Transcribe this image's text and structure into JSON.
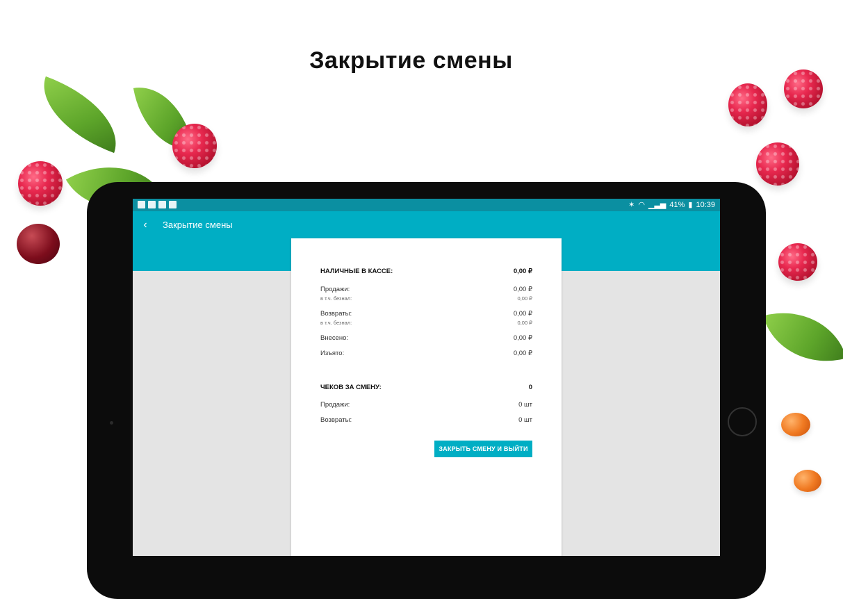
{
  "headline": "Закрытие смены",
  "status_bar": {
    "battery": "41%",
    "time": "10:39"
  },
  "app_bar": {
    "title": "Закрытие смены"
  },
  "summary": {
    "cash_label": "НАЛИЧНЫЕ В КАССЕ:",
    "cash_value": "0,00 ₽",
    "sales_label": "Продажи:",
    "sales_value": "0,00 ₽",
    "sales_cashless_label": "в т.ч. безнал:",
    "sales_cashless_value": "0,00 ₽",
    "returns_label": "Возвраты:",
    "returns_value": "0,00 ₽",
    "returns_cashless_label": "в т.ч. безнал:",
    "returns_cashless_value": "0,00 ₽",
    "deposited_label": "Внесено:",
    "deposited_value": "0,00 ₽",
    "withdrawn_label": "Изъято:",
    "withdrawn_value": "0,00 ₽",
    "receipts_label": "ЧЕКОВ ЗА СМЕНУ:",
    "receipts_value": "0",
    "receipts_sales_label": "Продажи:",
    "receipts_sales_value": "0 шт",
    "receipts_returns_label": "Возвраты:",
    "receipts_returns_value": "0 шт"
  },
  "actions": {
    "close_shift_label": "ЗАКРЫТЬ СМЕНУ И ВЫЙТИ"
  },
  "colors": {
    "accent": "#00aec4",
    "status_bar": "#0b8fa1"
  }
}
